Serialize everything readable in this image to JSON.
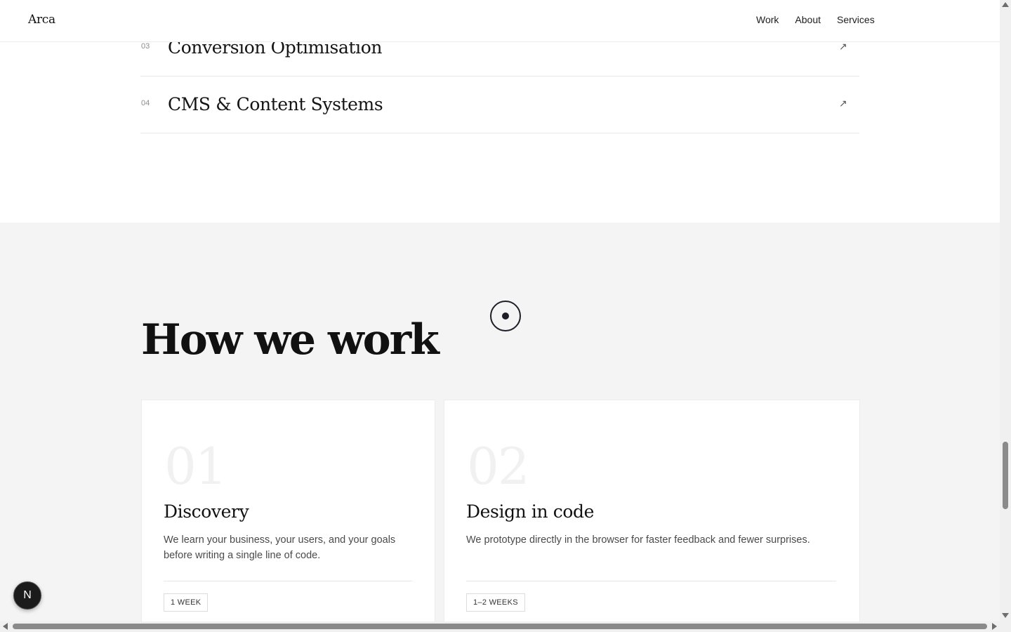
{
  "header": {
    "logo": "Arca",
    "nav": [
      "Work",
      "About",
      "Services"
    ]
  },
  "services": [
    {
      "num": "03",
      "title": "Conversion Optimisation",
      "arrow": "↗"
    },
    {
      "num": "04",
      "title": "CMS & Content Systems",
      "arrow": "↗"
    }
  ],
  "how": {
    "title": "How we work",
    "cards": [
      {
        "num": "01",
        "title": "Discovery",
        "desc": "We learn your business, your users, and your goals before writing a single line of code.",
        "badge": "1 WEEK"
      },
      {
        "num": "02",
        "title": "Design in code",
        "desc": "We prototype directly in the browser for faster feedback and fewer surprises.",
        "badge": "1–2 WEEKS"
      }
    ]
  },
  "dev_badge": {
    "label": "N",
    "icon": "nextjs-icon"
  }
}
